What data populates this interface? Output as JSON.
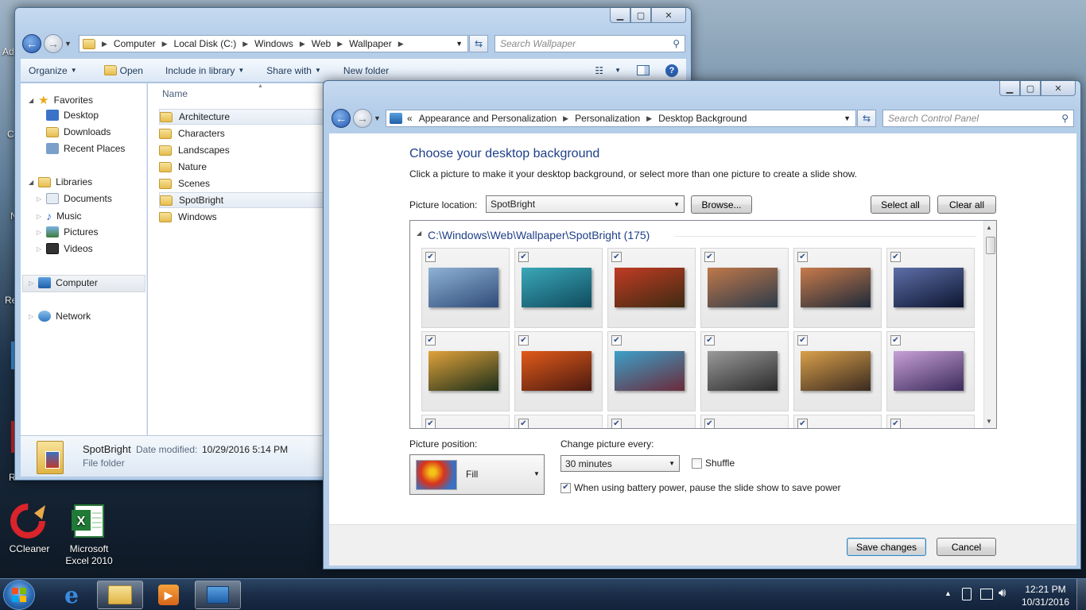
{
  "desktop": {
    "icons": [
      {
        "label": "CCleaner"
      },
      {
        "label": "Microsoft Excel 2010"
      }
    ],
    "edge_labels": [
      "Ad",
      "C",
      "N",
      "Re",
      "R"
    ]
  },
  "explorer": {
    "caption_buttons": {
      "minimize": "▁",
      "maximize": "▢",
      "close": "✕"
    },
    "breadcrumb": [
      "Computer",
      "Local Disk (C:)",
      "Windows",
      "Web",
      "Wallpaper"
    ],
    "search_placeholder": "Search Wallpaper",
    "toolbar": {
      "organize": "Organize",
      "open": "Open",
      "include": "Include in library",
      "share": "Share with",
      "new_folder": "New folder"
    },
    "nav": {
      "favorites": "Favorites",
      "desktop": "Desktop",
      "downloads": "Downloads",
      "recent": "Recent Places",
      "libraries": "Libraries",
      "documents": "Documents",
      "music": "Music",
      "pictures": "Pictures",
      "videos": "Videos",
      "computer": "Computer",
      "network": "Network"
    },
    "column_name": "Name",
    "files": [
      "Architecture",
      "Characters",
      "Landscapes",
      "Nature",
      "Scenes",
      "SpotBright",
      "Windows"
    ],
    "details": {
      "name": "SpotBright",
      "date_label": "Date modified:",
      "date_value": "10/29/2016 5:14 PM",
      "type": "File folder"
    }
  },
  "control_panel": {
    "caption_buttons": {
      "minimize": "▁",
      "maximize": "▢",
      "close": "✕"
    },
    "breadcrumb_prefix": "«",
    "breadcrumb": [
      "Appearance and Personalization",
      "Personalization",
      "Desktop Background"
    ],
    "search_placeholder": "Search Control Panel",
    "heading": "Choose your desktop background",
    "subtitle": "Click a picture to make it your desktop background, or select more than one picture to create a slide show.",
    "picture_location_label": "Picture location:",
    "picture_location_value": "SpotBright",
    "browse": "Browse...",
    "select_all": "Select all",
    "clear_all": "Clear all",
    "group_title": "C:\\Windows\\Web\\Wallpaper\\SpotBright (175)",
    "picture_position_label": "Picture position:",
    "picture_position_value": "Fill",
    "change_every_label": "Change picture every:",
    "change_every_value": "30 minutes",
    "shuffle": "Shuffle",
    "shuffle_checked": false,
    "battery": "When using battery power, pause the slide show to save power",
    "battery_checked": true,
    "save": "Save changes",
    "cancel": "Cancel",
    "thumb_colors": [
      [
        "#2e4b78",
        "#8fb2d6"
      ],
      [
        "#0f4b5e",
        "#3aa8b8"
      ],
      [
        "#3d2b12",
        "#c23b24"
      ],
      [
        "#2d3b4a",
        "#c0784a"
      ],
      [
        "#1d2a3a",
        "#c97a4a"
      ],
      [
        "#0d1530",
        "#5d6fa8"
      ],
      [
        "#1a2e1a",
        "#e1a23b"
      ],
      [
        "#4a1a10",
        "#e25a1a"
      ],
      [
        "#6b2a3a",
        "#3ca0c9"
      ],
      [
        "#2a2a2a",
        "#9a9a9a"
      ],
      [
        "#3a2a20",
        "#d9a04a"
      ],
      [
        "#3a2a5a",
        "#c8a0d8"
      ]
    ]
  },
  "taskbar": {
    "time": "12:21 PM",
    "date": "10/31/2016"
  }
}
